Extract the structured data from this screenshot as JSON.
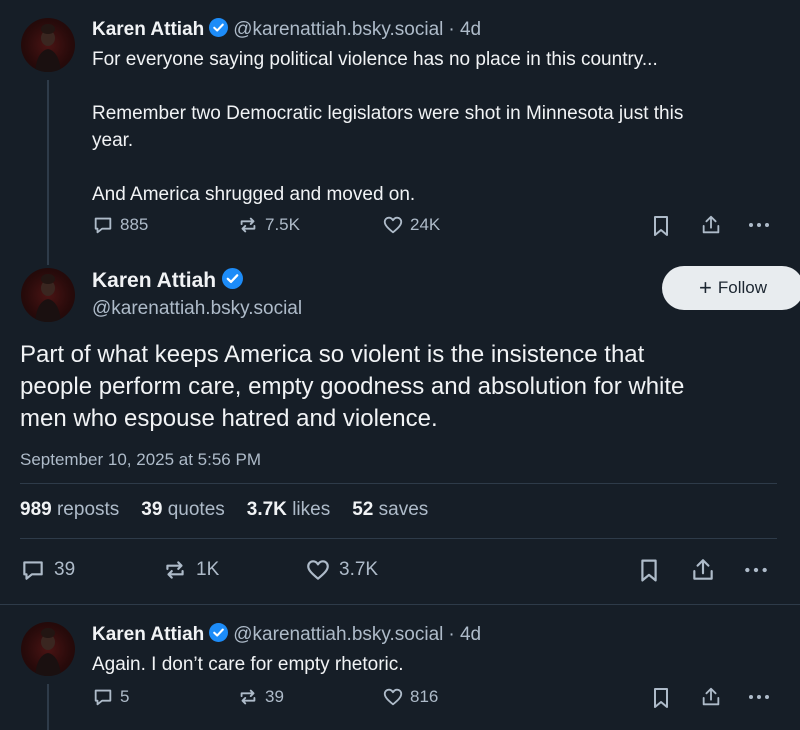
{
  "posts": [
    {
      "author_name": "Karen Attiah",
      "handle": "@karenattiah.bsky.social",
      "age": "· 4d",
      "lines": [
        "For everyone saying political violence has no place in this country...",
        "Remember two Democratic legislators were shot in Minnesota just this",
        "year.",
        "And America shrugged and moved on."
      ],
      "replies": "885",
      "reposts": "7.5K",
      "likes": "24K"
    },
    {
      "author_name": "Karen Attiah",
      "handle": "@karenattiah.bsky.social",
      "age": "· 4d",
      "lines": [
        "Again. I don’t care for empty rhetoric."
      ],
      "replies": "5",
      "reposts": "39",
      "likes": "816"
    }
  ],
  "main_post": {
    "author_name": "Karen Attiah",
    "handle": "@karenattiah.bsky.social",
    "follow_label": "Follow",
    "follow_icon": "+",
    "lines": [
      "Part of what keeps America so violent is the insistence that",
      "people perform care, empty goodness and absolution for white",
      "men who espouse hatred and  violence."
    ],
    "timestamp": "September 10, 2025 at 5:56 PM",
    "stats": [
      {
        "num": "989",
        "label": "reposts"
      },
      {
        "num": "39",
        "label": "quotes"
      },
      {
        "num": "3.7K",
        "label": "likes"
      },
      {
        "num": "52",
        "label": "saves"
      }
    ],
    "replies": "39",
    "reposts": "1K",
    "likes": "3.7K"
  },
  "colors": {
    "background": "#161e27",
    "verified": "#1d8cf8",
    "muted": "#aebbc9"
  }
}
